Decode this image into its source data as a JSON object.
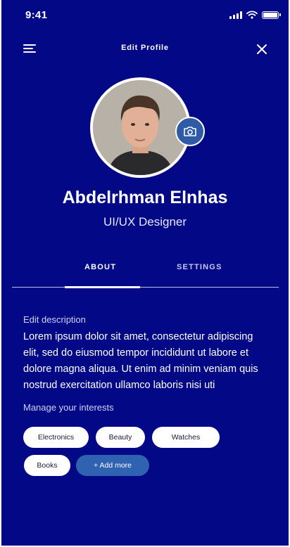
{
  "status_bar": {
    "time": "9:41"
  },
  "header": {
    "title": "Edit Profile"
  },
  "profile": {
    "name": "Abdelrhman Elnhas",
    "role": "UI/UX Designer"
  },
  "tabs": [
    {
      "label": "ABOUT",
      "active": true
    },
    {
      "label": "SETTINGS",
      "active": false
    }
  ],
  "about": {
    "description_label": "Edit description",
    "description": "Lorem ipsum dolor sit amet, consectetur adipiscing elit, sed do eiusmod tempor incididunt ut labore et dolore magna aliqua. Ut enim ad minim veniam quis nostrud exercitation ullamco laboris nisi uti",
    "interests_label": "Manage your interests",
    "interests": [
      "Electronics",
      "Beauty",
      "Watches",
      "Books"
    ],
    "add_more_label": "+ Add more"
  },
  "colors": {
    "background": "#020886",
    "accent": "#2f62b0",
    "chip": "#ffffff"
  },
  "icons": {
    "menu": "menu-icon",
    "close": "close-icon",
    "camera": "camera-icon"
  }
}
